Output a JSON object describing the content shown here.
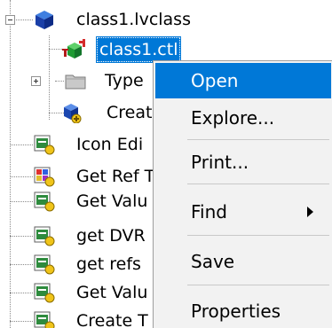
{
  "tree": {
    "root": {
      "label": "class1.lvclass",
      "icon": "lvclass-cube-icon"
    },
    "children": [
      {
        "label": "class1.ctl",
        "icon": "class-control-icon",
        "selected": true
      },
      {
        "label": "Type",
        "icon": "folder-icon",
        "expandable": true
      },
      {
        "label": "Creat",
        "icon": "create-vi-icon"
      }
    ],
    "methods": [
      {
        "label": "Icon Edi",
        "icon": "vi-icon"
      },
      {
        "label": "Get Ref T",
        "icon": "colorful-vi-icon"
      },
      {
        "label": "Get Valu",
        "icon": "vi-icon"
      },
      {
        "label": "get DVR",
        "icon": "vi-icon"
      },
      {
        "label": "get refs",
        "icon": "vi-icon"
      },
      {
        "label": "Get Valu",
        "icon": "vi-icon"
      },
      {
        "label": "Create T",
        "icon": "vi-icon"
      }
    ]
  },
  "context_menu": {
    "items": [
      {
        "label": "Open",
        "highlighted": true
      },
      {
        "label": "Explore..."
      },
      {
        "label": "Print..."
      },
      {
        "label": "Find",
        "submenu": true
      },
      {
        "label": "Save"
      },
      {
        "label": "Properties"
      }
    ]
  },
  "colors": {
    "selection": "#0078d7",
    "menu_background": "#f2f2f2"
  }
}
